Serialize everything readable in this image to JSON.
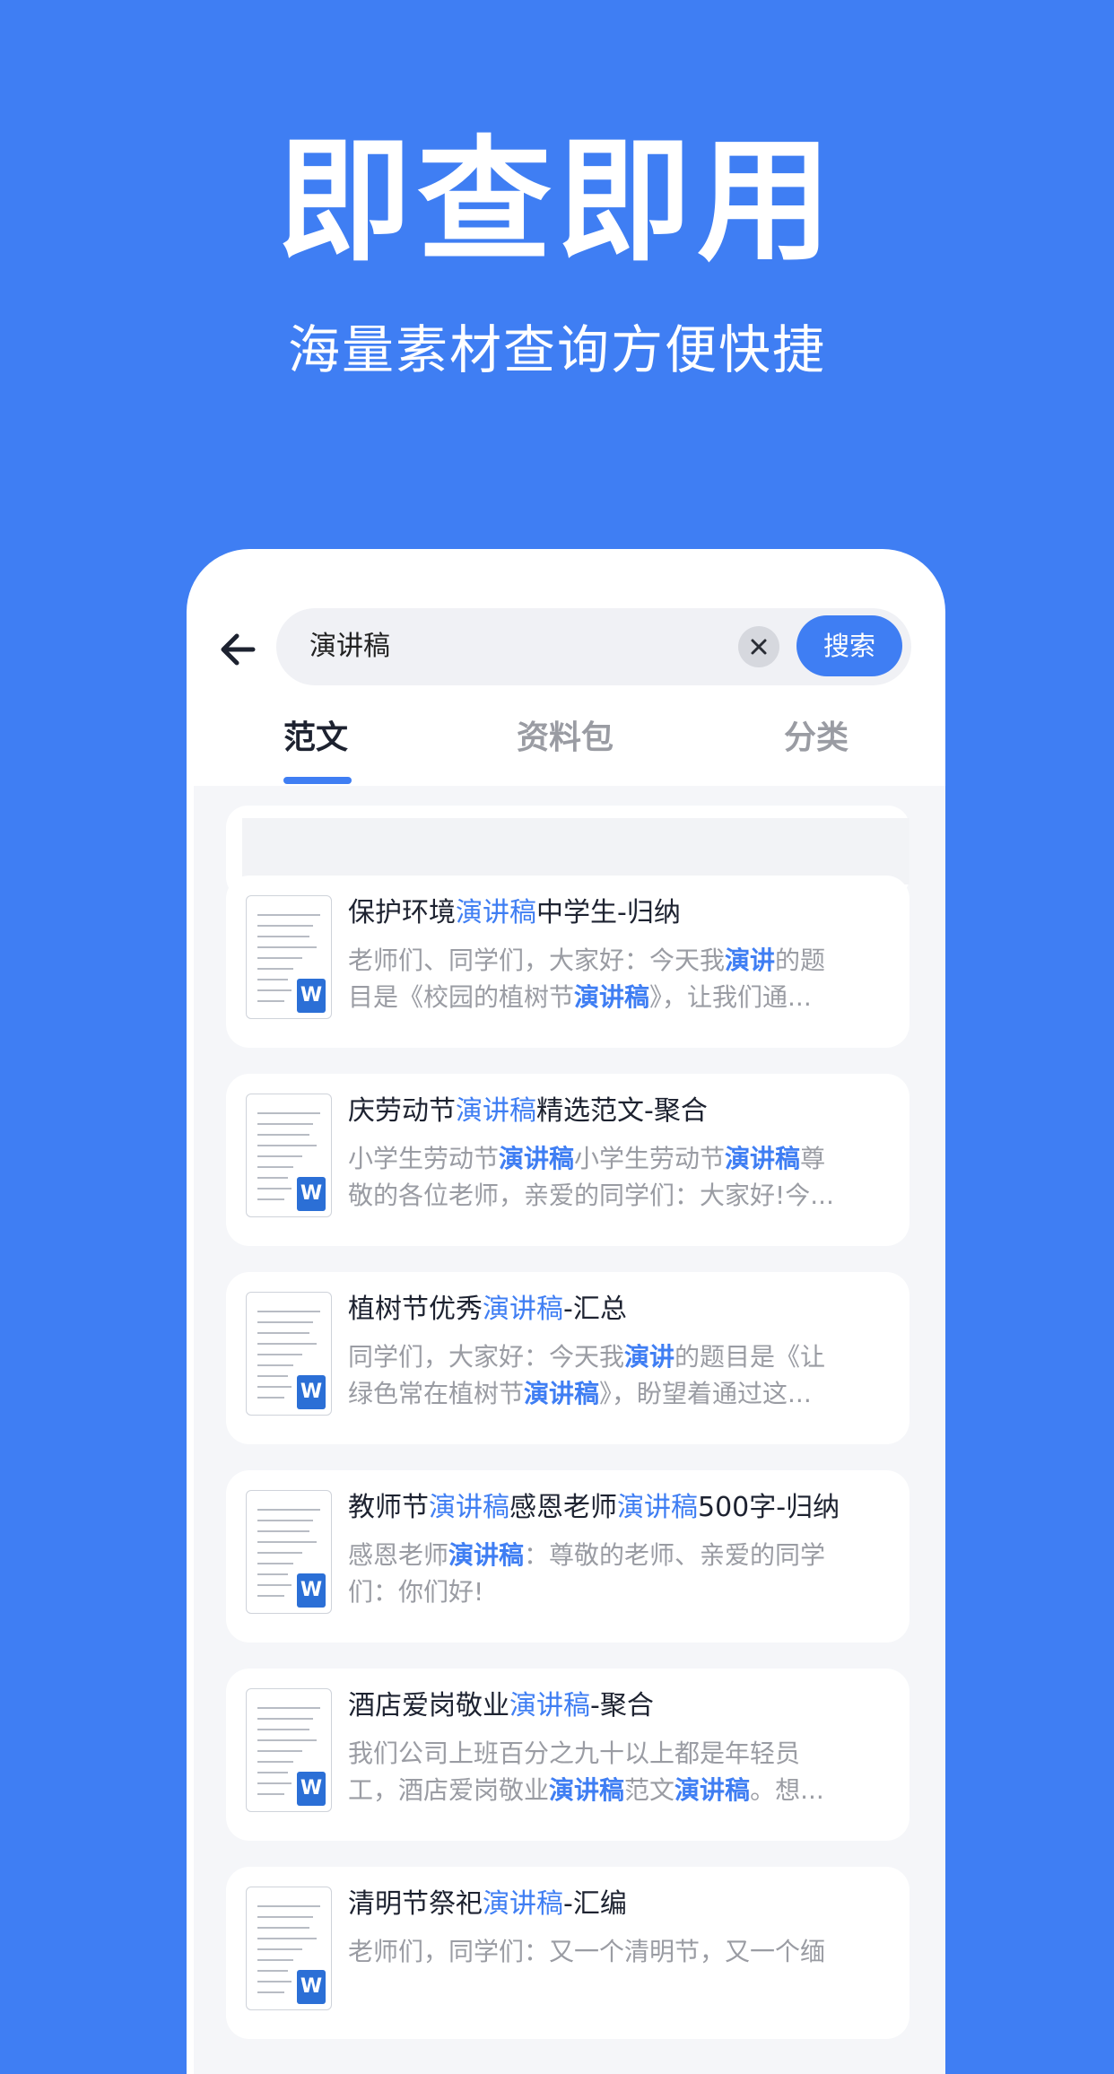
{
  "hero": {
    "title": "即查即用",
    "subtitle": "海量素材查询方便快捷"
  },
  "search": {
    "query": "演讲稿",
    "button": "搜索"
  },
  "tabs": [
    {
      "label": "范文",
      "active": true
    },
    {
      "label": "资料包",
      "active": false
    },
    {
      "label": "分类",
      "active": false
    }
  ],
  "results": [
    {
      "title": [
        {
          "t": "保护环境"
        },
        {
          "t": "演讲稿",
          "hl": true
        },
        {
          "t": "中学生-归纳"
        }
      ],
      "line1": [
        {
          "t": "老师们、同学们，大家好：今天我"
        },
        {
          "t": "演讲",
          "hl": true
        },
        {
          "t": "的题"
        }
      ],
      "line2": [
        {
          "t": "目是《校园的植树节"
        },
        {
          "t": "演讲稿",
          "hl": true
        },
        {
          "t": "》，让我们通..."
        }
      ]
    },
    {
      "title": [
        {
          "t": "庆劳动节"
        },
        {
          "t": "演讲稿",
          "hl": true
        },
        {
          "t": "精选范文-聚合"
        }
      ],
      "line1": [
        {
          "t": "小学生劳动节"
        },
        {
          "t": "演讲稿",
          "hl": true
        },
        {
          "t": "小学生劳动节"
        },
        {
          "t": "演讲稿",
          "hl": true
        },
        {
          "t": "尊"
        }
      ],
      "line2": [
        {
          "t": "敬的各位老师，亲爱的同学们：大家好!今..."
        }
      ]
    },
    {
      "title": [
        {
          "t": "植树节优秀"
        },
        {
          "t": "演讲稿",
          "hl": true
        },
        {
          "t": "-汇总"
        }
      ],
      "line1": [
        {
          "t": "同学们，大家好：今天我"
        },
        {
          "t": "演讲",
          "hl": true
        },
        {
          "t": "的题目是《让"
        }
      ],
      "line2": [
        {
          "t": "绿色常在植树节"
        },
        {
          "t": "演讲稿",
          "hl": true
        },
        {
          "t": "》，盼望着通过这..."
        }
      ]
    },
    {
      "title": [
        {
          "t": "教师节"
        },
        {
          "t": "演讲稿",
          "hl": true
        },
        {
          "t": "感恩老师"
        },
        {
          "t": "演讲稿",
          "hl": true
        },
        {
          "t": "500字-归纳"
        }
      ],
      "line1": [
        {
          "t": "感恩老师"
        },
        {
          "t": "演讲稿",
          "hl": true
        },
        {
          "t": "：尊敬的老师、亲爱的同学"
        }
      ],
      "line2": [
        {
          "t": "们：你们好!"
        }
      ]
    },
    {
      "title": [
        {
          "t": "酒店爱岗敬业"
        },
        {
          "t": "演讲稿",
          "hl": true
        },
        {
          "t": "-聚合"
        }
      ],
      "line1": [
        {
          "t": "我们公司上班百分之九十以上都是年轻员"
        }
      ],
      "line2": [
        {
          "t": "工，酒店爱岗敬业"
        },
        {
          "t": "演讲稿",
          "hl": true
        },
        {
          "t": "范文"
        },
        {
          "t": "演讲稿",
          "hl": true
        },
        {
          "t": "。想..."
        }
      ]
    },
    {
      "title": [
        {
          "t": "清明节祭祀"
        },
        {
          "t": "演讲稿",
          "hl": true
        },
        {
          "t": "-汇编"
        }
      ],
      "line1": [
        {
          "t": "老师们，同学们：又一个清明节，又一个缅"
        }
      ],
      "line2": [
        {
          "t": ""
        }
      ]
    }
  ],
  "icons": {
    "back": "arrow-left-icon",
    "clear": "close-icon",
    "doc": "word-document-icon"
  },
  "colors": {
    "accent": "#3f7ef3",
    "text": "#1d2230",
    "muted": "#9a9ca3"
  }
}
